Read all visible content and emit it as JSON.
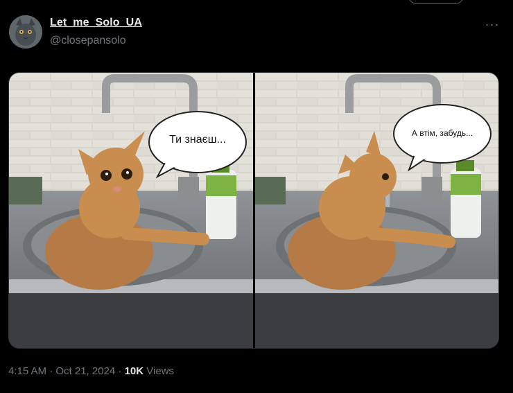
{
  "tweet": {
    "display_name": "Let_me_Solo_UA",
    "handle": "@closepansolo",
    "more_icon": "more-horizontal-icon",
    "timestamp": "4:15 AM · Oct 21, 2024 · ",
    "views_count": "10K",
    "views_label": " Views"
  },
  "media": {
    "left_panel": {
      "bubble_text": "Ти знаєш..."
    },
    "right_panel": {
      "bubble_text": "А втім, забудь..."
    }
  },
  "colors": {
    "background": "#000000",
    "primary_text": "#e7e9ea",
    "secondary_text": "#71767b",
    "cat_fur": "#c98d50"
  }
}
